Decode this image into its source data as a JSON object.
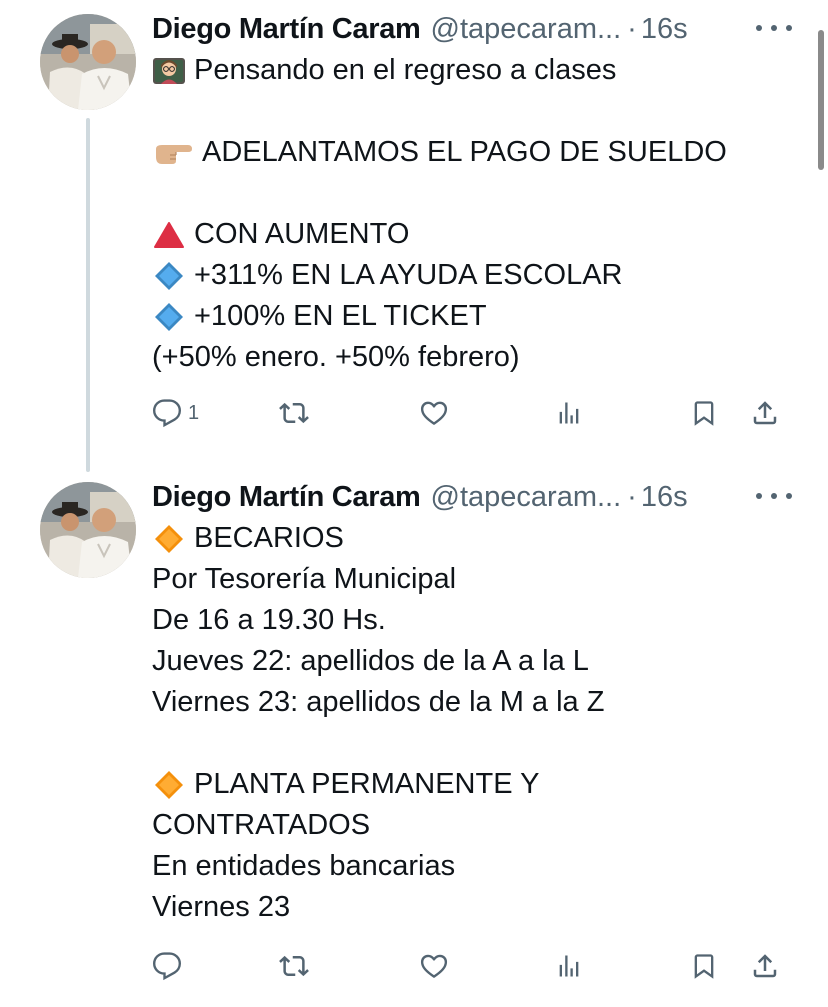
{
  "tweets": [
    {
      "author_name": "Diego Martín Caram",
      "handle": "@tapecaram...",
      "separator": "·",
      "time": "16s",
      "lines": [
        {
          "emoji": "teacher-emoji",
          "text": "Pensando en el regreso a clases"
        },
        {
          "emoji": "",
          "text": ""
        },
        {
          "emoji": "pointing-hand-emoji",
          "text": "ADELANTAMOS EL PAGO DE SUELDO"
        },
        {
          "emoji": "",
          "text": ""
        },
        {
          "emoji": "red-triangle-emoji",
          "text": "CON AUMENTO"
        },
        {
          "emoji": "blue-diamond-emoji",
          "text": "+311% EN LA AYUDA ESCOLAR"
        },
        {
          "emoji": "blue-diamond-emoji",
          "text": "+100% EN EL TICKET"
        },
        {
          "emoji": "",
          "text": "(+50% enero. +50% febrero)"
        }
      ],
      "reply_count": "1"
    },
    {
      "author_name": "Diego Martín Caram",
      "handle": "@tapecaram...",
      "separator": "·",
      "time": "16s",
      "lines": [
        {
          "emoji": "orange-diamond-emoji",
          "text": "BECARIOS"
        },
        {
          "emoji": "",
          "text": "Por Tesorería Municipal"
        },
        {
          "emoji": "",
          "text": "De 16 a 19.30 Hs."
        },
        {
          "emoji": "",
          "text": "Jueves 22: apellidos de la A a la L"
        },
        {
          "emoji": "",
          "text": "Viernes 23: apellidos de la M a la Z"
        },
        {
          "emoji": "",
          "text": ""
        },
        {
          "emoji": "orange-diamond-emoji",
          "text": "PLANTA PERMANENTE Y"
        },
        {
          "emoji": "",
          "text": "CONTRATADOS"
        },
        {
          "emoji": "",
          "text": "En entidades bancarias"
        },
        {
          "emoji": "",
          "text": "Viernes 23"
        }
      ],
      "reply_count": ""
    }
  ],
  "colors": {
    "text": "#0f1419",
    "secondary": "#536471",
    "thread_line": "#cfd9de",
    "blue_diamond": "#3b88c3",
    "orange_diamond": "#f4900c",
    "red_triangle": "#dd2e44"
  },
  "icons": [
    "reply-icon",
    "retweet-icon",
    "like-icon",
    "views-icon",
    "bookmark-icon",
    "share-icon",
    "more-icon"
  ]
}
